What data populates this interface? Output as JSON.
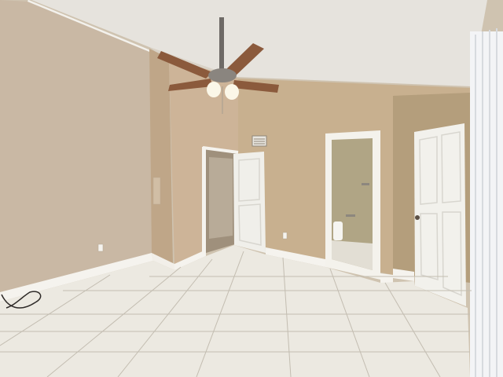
{
  "scene": {
    "kind": "photo",
    "description_free": true
  },
  "colors": {
    "ceiling": "#e6e3dd",
    "wall_left": "#c8b9a5",
    "wall_mid": "#c9b393",
    "wall_right": "#b9a482",
    "wall_column": "#cdb79a",
    "trim": "#f5f3ee",
    "door": "#f2f1ec",
    "floor": "#ece9e1",
    "grout": "#b8b2a6",
    "fan_blade": "#8b5a3c",
    "fan_metal": "#6e6a66",
    "light_glass": "#fbf7e8",
    "bath_wall": "#b5a98a",
    "blinds": "#f3f4f6"
  },
  "icons": [
    "ceiling-fan-icon",
    "air-vent-icon",
    "electrical-outlet-icon",
    "cable-icon"
  ]
}
